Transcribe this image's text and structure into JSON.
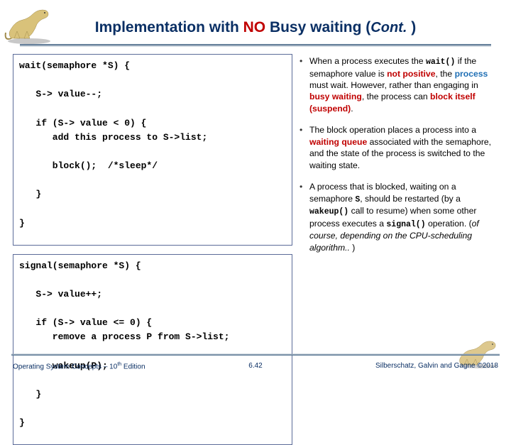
{
  "title": {
    "pre": "Implementation with ",
    "no": "NO",
    "post": " Busy waiting (",
    "cont": "Cont.",
    "close": " )"
  },
  "code": {
    "wait": "wait(semaphore *S) { \n\n   S-> value--; \n\n   if (S-> value < 0) {\n      add this process to S->list; \n\n      block();  /*sleep*/\n\n   } \n\n}",
    "signal": "signal(semaphore *S) { \n\n   S-> value++; \n\n   if (S-> value <= 0) {\n      remove a process P from S->list; \n\n      wakeup(P); \n\n   } \n\n}"
  },
  "bullets": {
    "b1": {
      "t1": "When a process executes the ",
      "m1": "wait()",
      "t2": " if the semaphore value is ",
      "np": "not positive",
      "t3": ", the ",
      "pr": "process",
      "t4": " must wait. However, rather than engaging in ",
      "bw": "busy waiting",
      "t5": ", the process can ",
      "bi": "block itself (suspend)",
      "t6": "."
    },
    "b2": {
      "t1": "The block operation places a process into a ",
      "wq": "waiting queue",
      "t2": " associated with the semaphore, and the state of the process is switched to the waiting state."
    },
    "b3": {
      "t1": "A process that is blocked, waiting on a semaphore ",
      "m1": "S",
      "t2": ", should be restarted (by a ",
      "m2": "wakeup()",
      "t3": " call to resume) when some other process executes a ",
      "m3": "signal()",
      "t4": " operation. (",
      "it": "of course, depending on the CPU-scheduling algorithm..",
      "t5": " )"
    }
  },
  "footer": {
    "left_pre": "Operating System Concepts – 10",
    "left_sup": "th",
    "left_post": " Edition",
    "center": "6.42",
    "right": "Silberschatz, Galvin and Gagne ©2018"
  }
}
